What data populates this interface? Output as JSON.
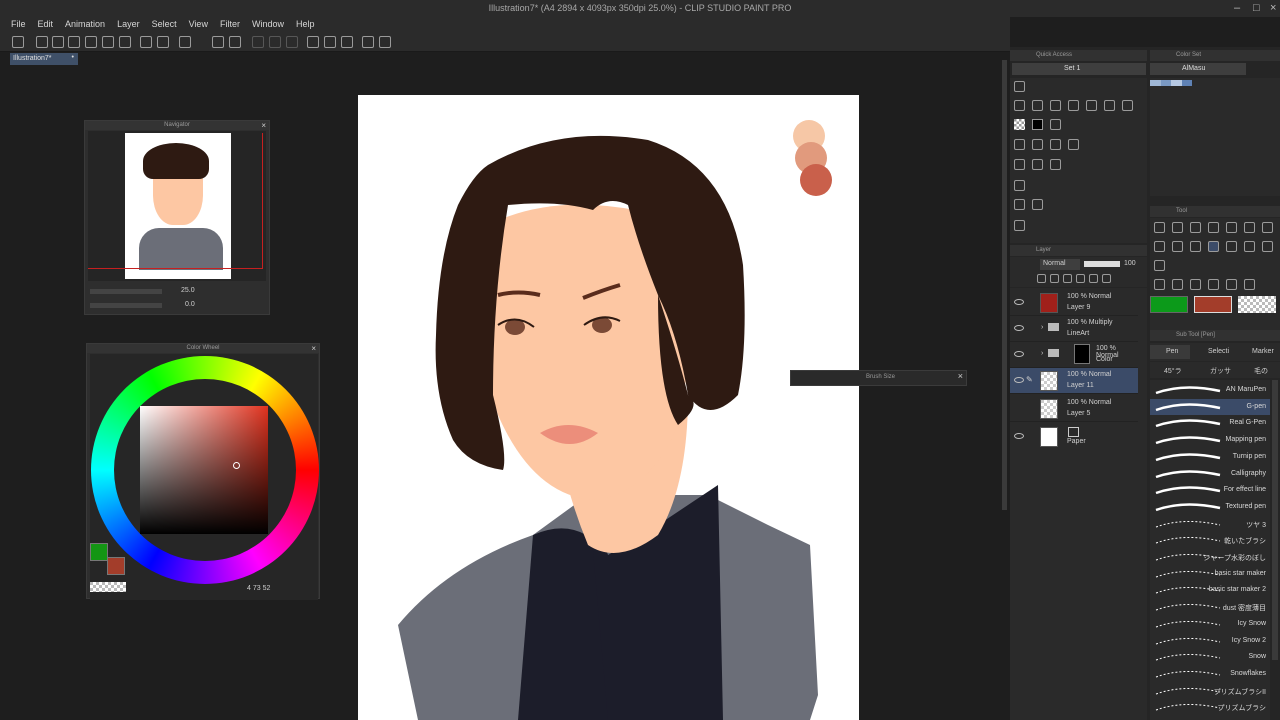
{
  "app": {
    "title": "Illustration7* (A4 2894 x 4093px 350dpi 25.0%) - CLIP STUDIO PAINT PRO"
  },
  "menu": [
    "File",
    "Edit",
    "Animation",
    "Layer",
    "Select",
    "View",
    "Filter",
    "Window",
    "Help"
  ],
  "doc_tab": "Illustration7*",
  "navigator": {
    "title": "Navigator",
    "zoom": "25.0",
    "rotation": "0.0"
  },
  "color_wheel": {
    "title": "Color Wheel",
    "main_color": "#149614",
    "sub_color": "#a33d2a",
    "readout": "4  73  52"
  },
  "brush_size": {
    "title": "Brush Size"
  },
  "quick_access": {
    "title": "Quick Access",
    "set": "Set 1"
  },
  "color_set": {
    "title": "Color Set",
    "set": "AlMasu",
    "swatches": [
      "#9fb7d5",
      "#7a99c3",
      "#b6c9e3",
      "#5f82b5"
    ]
  },
  "tool": {
    "title": "Tool",
    "main_color": "#0c9a1a",
    "sub_color": "#a33d2a"
  },
  "sub_tool": {
    "title": "Sub Tool [Pen]",
    "tabs": [
      "Pen",
      "Selecti",
      "Marker"
    ],
    "row2": [
      "45°ラ",
      "ガッサ",
      "毛の"
    ]
  },
  "layer_panel": {
    "title": "Layer",
    "blend": "Normal",
    "opacity": "100",
    "layers": [
      {
        "opacity": "100 % Normal",
        "name": "Layer 9",
        "color": "#a0201a",
        "type": "raster"
      },
      {
        "opacity": "100 % Multiply",
        "name": "LineArt",
        "type": "folder"
      },
      {
        "opacity": "100 % Normal",
        "name": "Color",
        "type": "folder"
      },
      {
        "opacity": "100 % Normal",
        "name": "Layer 11",
        "type": "raster",
        "selected": true
      },
      {
        "opacity": "100 % Normal",
        "name": "Layer 5",
        "type": "raster"
      },
      {
        "opacity": "",
        "name": "Paper",
        "type": "paper"
      }
    ]
  },
  "brushes": [
    "AN MaruPen",
    "G-pen",
    "Real G-Pen",
    "Mapping pen",
    "Turnip pen",
    "Calligraphy",
    "For effect line",
    "Textured pen",
    "ツヤ 3",
    "乾いたブラシ",
    "シャープ水彩のぼし",
    "basic star maker",
    "basic star maker 2",
    "dust 密度薄目",
    "Icy Snow",
    "Icy Snow 2",
    "Snow",
    "Snowflakes",
    "プリズムブラシII",
    "プリズムブラシ"
  ],
  "selected_brush": "G-pen",
  "palette": [
    "#f6c7a6",
    "#e19a7d",
    "#c9604b"
  ]
}
